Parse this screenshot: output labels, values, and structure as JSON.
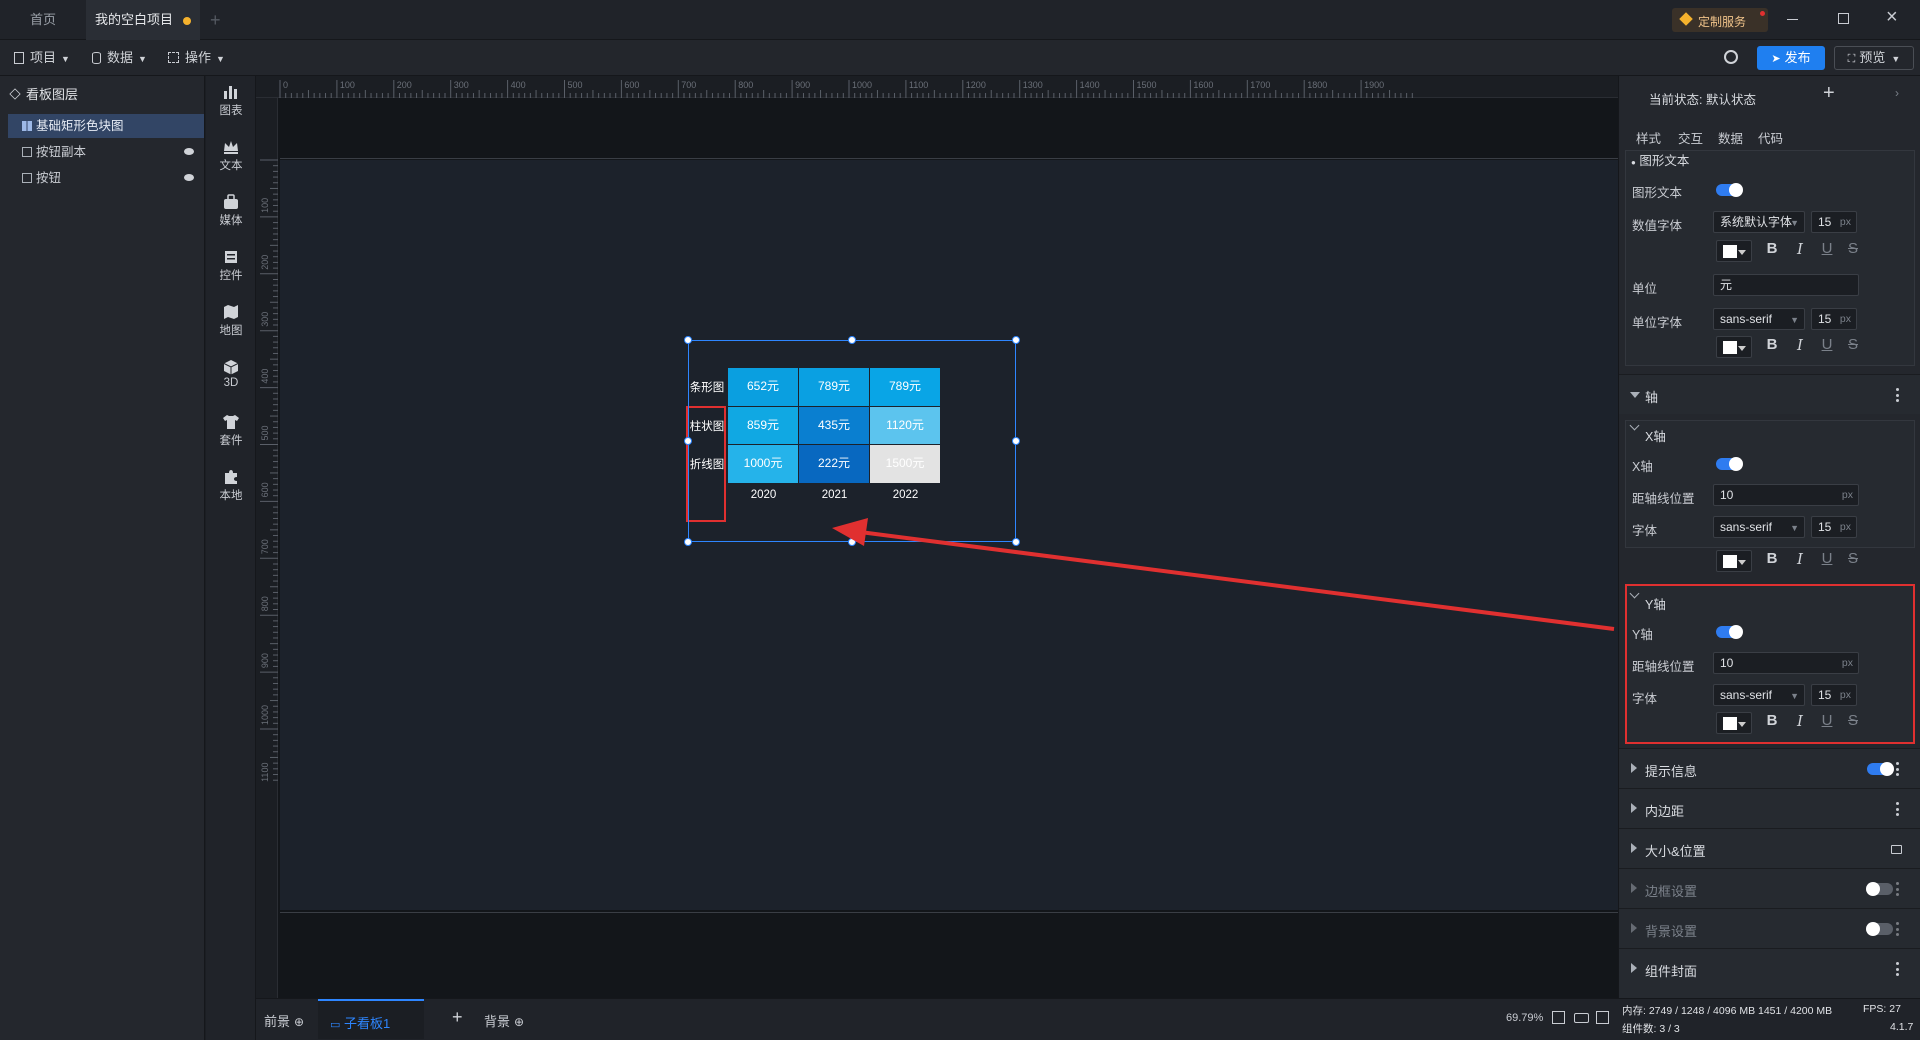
{
  "titlebar": {
    "tabs": [
      {
        "label": "首页"
      },
      {
        "label": "我的空白项目"
      }
    ],
    "custom_service": "定制服务"
  },
  "toolbar": {
    "menus": [
      {
        "label": "项目"
      },
      {
        "label": "数据"
      },
      {
        "label": "操作"
      }
    ],
    "publish": "发布",
    "preview": "预览"
  },
  "layers": {
    "title": "看板图层",
    "items": [
      {
        "label": "基础矩形色块图"
      },
      {
        "label": "按钮副本"
      },
      {
        "label": "按钮"
      }
    ]
  },
  "components": [
    {
      "label": "图表"
    },
    {
      "label": "文本"
    },
    {
      "label": "媒体"
    },
    {
      "label": "控件"
    },
    {
      "label": "地图"
    },
    {
      "label": "3D"
    },
    {
      "label": "套件"
    },
    {
      "label": "本地"
    }
  ],
  "ruler": {
    "top": [
      "0",
      "100",
      "200",
      "300",
      "400",
      "500",
      "600",
      "700",
      "800",
      "900",
      "1000",
      "1100",
      "1200",
      "1300",
      "1400",
      "1500",
      "1600",
      "1700",
      "1800",
      "1900"
    ],
    "left": [
      "100",
      "200",
      "300",
      "400",
      "500",
      "600",
      "700",
      "800",
      "900",
      "1000",
      "1100"
    ]
  },
  "chart_data": {
    "type": "heatmap",
    "categories": [
      "2020",
      "2021",
      "2022"
    ],
    "rows": [
      "条形图",
      "柱状图",
      "折线图"
    ],
    "values": [
      [
        652,
        789,
        789
      ],
      [
        859,
        435,
        1120
      ],
      [
        1000,
        222,
        1500
      ]
    ],
    "unit": "元",
    "cell_labels": [
      [
        "652元",
        "789元",
        "789元"
      ],
      [
        "859元",
        "435元",
        "1120元"
      ],
      [
        "1000元",
        "222元",
        "1500元"
      ]
    ],
    "colors": [
      [
        "#0a9fe0",
        "#0aa0e2",
        "#09a5e6"
      ],
      [
        "#10a8e3",
        "#0a7fd0",
        "#5cc4ee"
      ],
      [
        "#25b3ea",
        "#0868c0",
        "#e3e3e3"
      ]
    ],
    "highlight_color": "#e03030"
  },
  "props": {
    "state_label": "当前状态:",
    "state_value": "默认状态",
    "tabs": [
      {
        "label": "样式"
      },
      {
        "label": "交互"
      },
      {
        "label": "数据"
      },
      {
        "label": "代码"
      }
    ],
    "graphic_text": {
      "section": "图形文本",
      "toggle_label": "图形文本",
      "value_font_label": "数值字体",
      "value_font": "系统默认字体",
      "value_size": "15",
      "unit_label": "单位",
      "unit_value": "元",
      "unit_font_label": "单位字体",
      "unit_font": "sans-serif",
      "unit_size": "15"
    },
    "axis_section": "轴",
    "x_axis": {
      "header": "X轴",
      "toggle_label": "X轴",
      "offset_label": "距轴线位置",
      "offset": "10",
      "font_label": "字体",
      "font": "sans-serif",
      "size": "15"
    },
    "y_axis": {
      "header": "Y轴",
      "toggle_label": "Y轴",
      "offset_label": "距轴线位置",
      "offset": "10",
      "font_label": "字体",
      "font": "sans-serif",
      "size": "15"
    },
    "px": "px",
    "sections": [
      {
        "label": "提示信息"
      },
      {
        "label": "内边距"
      },
      {
        "label": "大小&位置"
      },
      {
        "label": "边框设置"
      },
      {
        "label": "背景设置"
      },
      {
        "label": "组件封面"
      }
    ]
  },
  "bottom": {
    "foreground": "前景",
    "board": "子看板1",
    "background": "背景",
    "zoom": "69.79%"
  },
  "status": {
    "memory": "内存: 2749 / 1248 / 4096 MB  1451 / 4200 MB",
    "fps": "FPS: 27",
    "count": "组件数: 3 / 3",
    "version": "4.1.7"
  }
}
